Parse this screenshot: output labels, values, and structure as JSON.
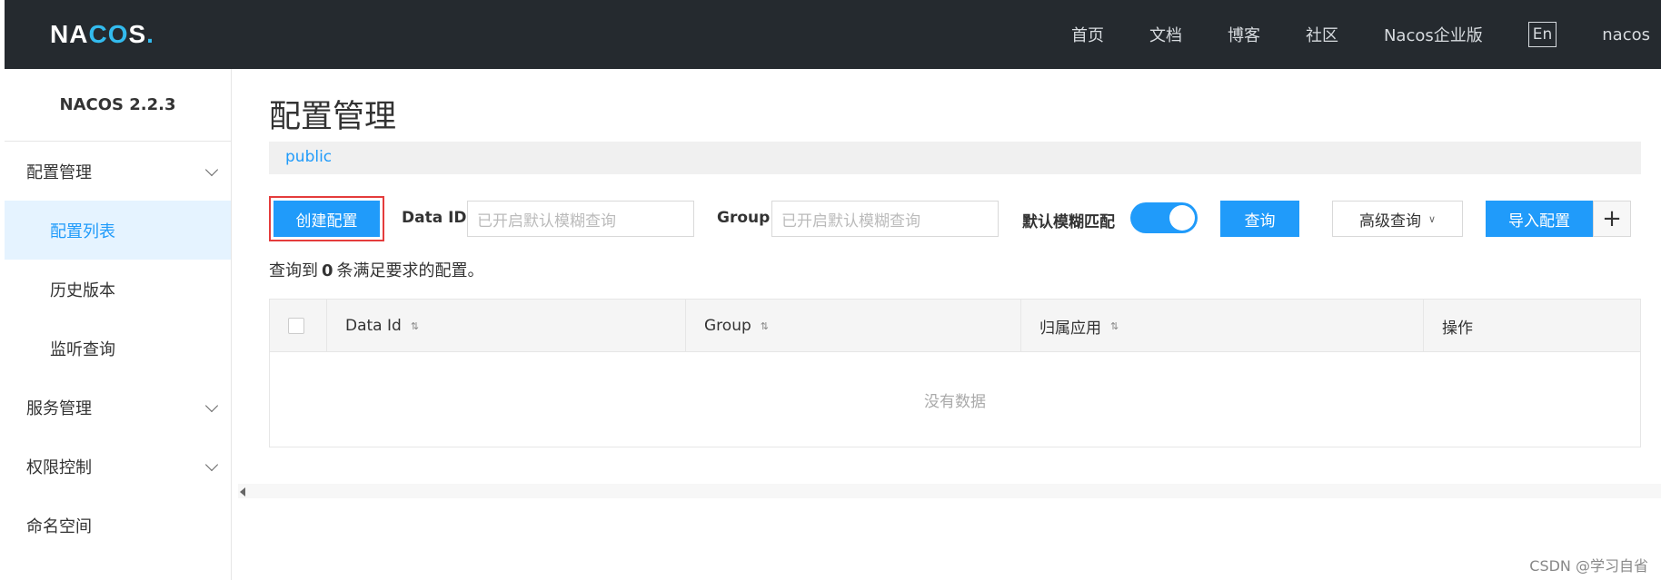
{
  "header": {
    "logo_text": "NACOS.",
    "nav": [
      "首页",
      "文档",
      "博客",
      "社区",
      "Nacos企业版"
    ],
    "lang": "En",
    "user": "nacos"
  },
  "sidebar": {
    "title": "NACOS 2.2.3",
    "groups": [
      {
        "label": "配置管理",
        "items": [
          "配置列表",
          "历史版本",
          "监听查询"
        ]
      },
      {
        "label": "服务管理"
      },
      {
        "label": "权限控制"
      },
      {
        "label": "命名空间"
      }
    ]
  },
  "main": {
    "title": "配置管理",
    "namespace": "public",
    "toolbar": {
      "create_label": "创建配置",
      "dataid_label": "Data ID",
      "dataid_placeholder": "已开启默认模糊查询",
      "group_label": "Group",
      "group_placeholder": "已开启默认模糊查询",
      "fuzzy_label": "默认模糊匹配",
      "fuzzy_on": true,
      "query_label": "查询",
      "advanced_label": "高级查询",
      "import_label": "导入配置",
      "plus_label": "+"
    },
    "result": {
      "prefix": "查询到",
      "count": "0",
      "suffix": "条满足要求的配置。"
    },
    "table": {
      "columns": [
        "Data Id",
        "Group",
        "归属应用",
        "操作"
      ],
      "empty_text": "没有数据"
    }
  },
  "watermark": "CSDN @学习自省",
  "colors": {
    "primary": "#209bfa",
    "topbar": "#252a2f",
    "highlight_border": "#e43c3c"
  }
}
